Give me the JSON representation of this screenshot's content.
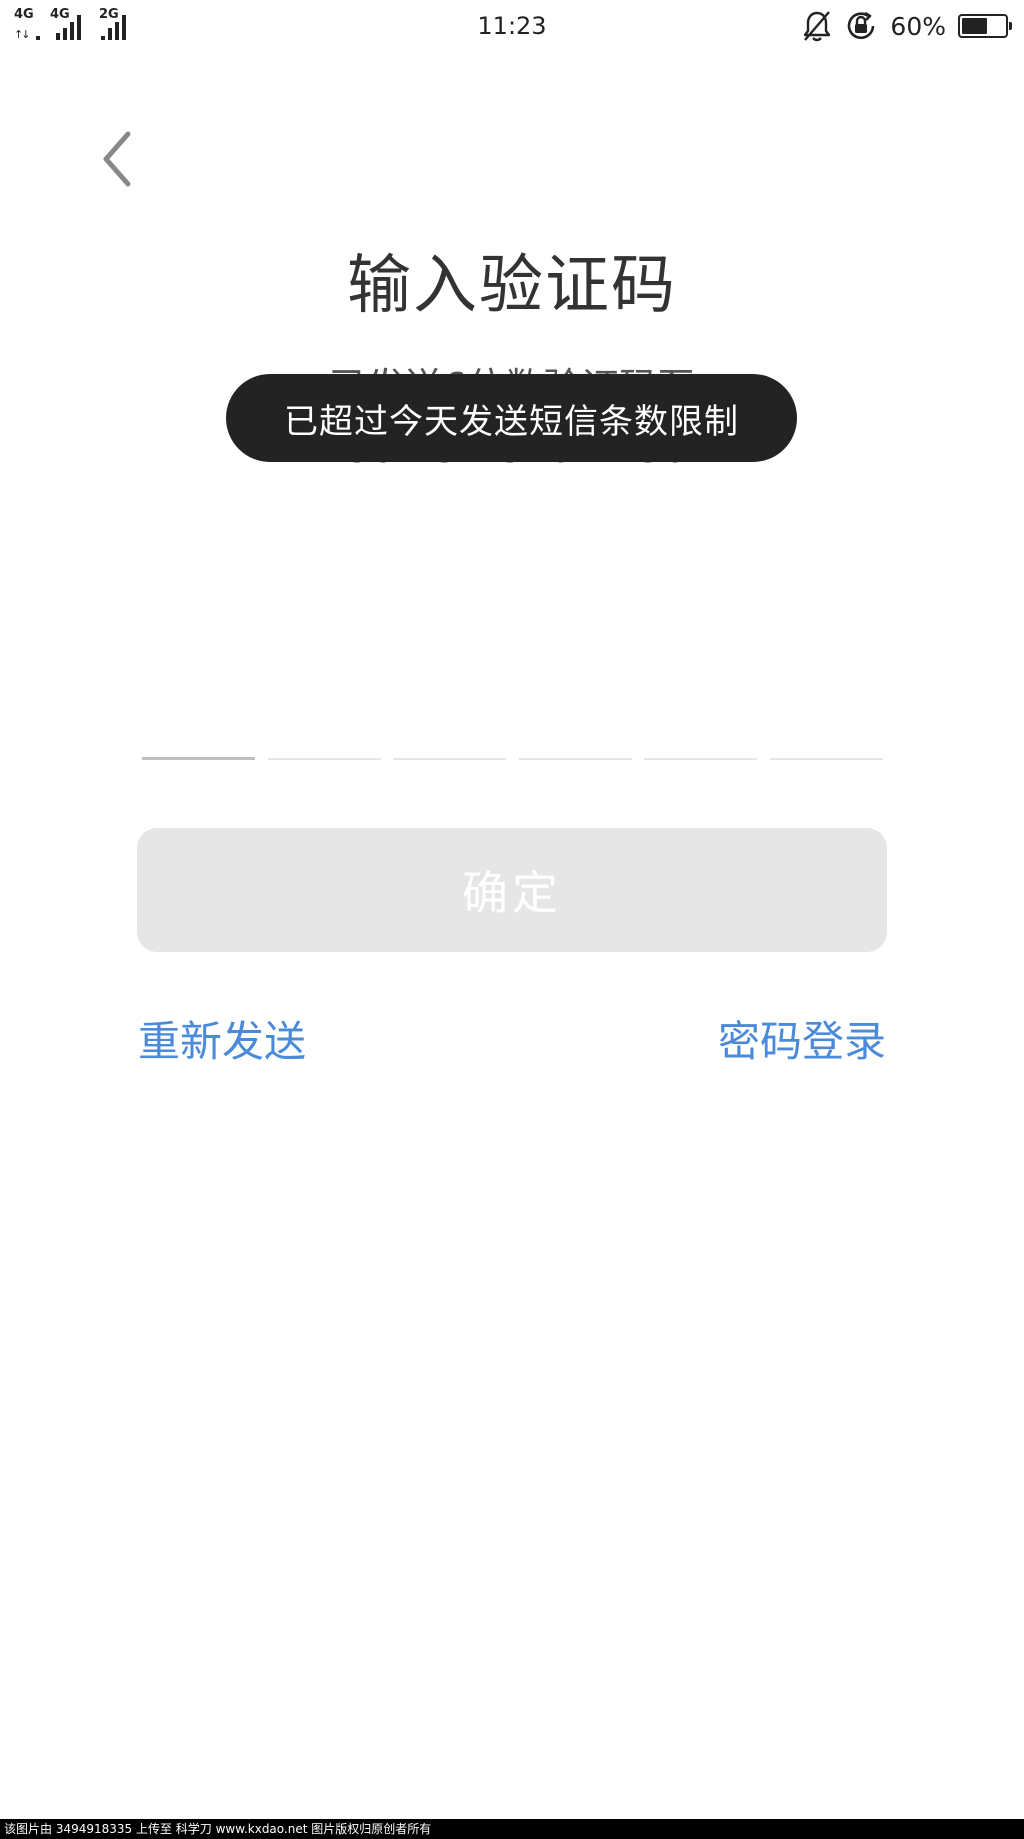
{
  "status_bar": {
    "network_1": "4G",
    "network_2": "4G",
    "network_3": "2G",
    "arrows": "↑↓",
    "time": "11:23",
    "battery_percent": "60%",
    "battery_level": 0.6,
    "icons": [
      "bell-off-icon",
      "rotation-lock-icon",
      "battery-icon"
    ]
  },
  "page": {
    "title": "输入验证码",
    "subtitle": "已发送6位数验证码至",
    "phone": "+86 132 8207 4301"
  },
  "code_input": {
    "length": 6
  },
  "actions": {
    "confirm_label": "确定",
    "resend_label": "重新发送",
    "password_login_label": "密码登录"
  },
  "toast": {
    "message": "已超过今天发送短信条数限制"
  },
  "colors": {
    "link": "#4a8ad9",
    "button_disabled": "#e6e6e6",
    "toast_bg": "#232323"
  },
  "footer": {
    "watermark": "该图片由 3494918335 上传至 科学刀 www.kxdao.net 图片版权归原创者所有"
  }
}
